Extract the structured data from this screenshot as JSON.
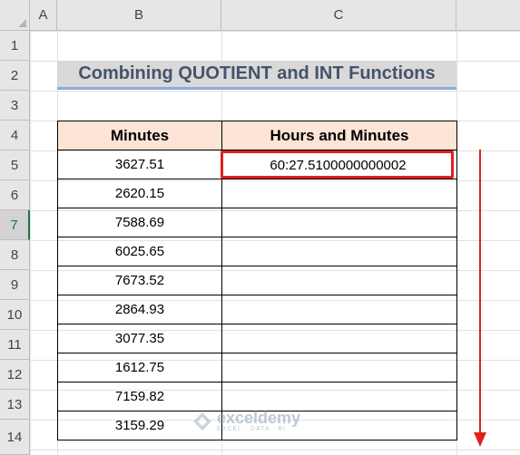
{
  "columns": [
    "A",
    "B",
    "C"
  ],
  "rows": [
    "1",
    "2",
    "3",
    "4",
    "5",
    "6",
    "7",
    "8",
    "9",
    "10",
    "11",
    "12",
    "13",
    "14"
  ],
  "title": "Combining QUOTIENT and INT Functions",
  "table": {
    "headers": [
      "Minutes",
      "Hours and Minutes"
    ],
    "minutes": [
      "3627.51",
      "2620.15",
      "7588.69",
      "6025.65",
      "7673.52",
      "2864.93",
      "3077.35",
      "1612.75",
      "7159.82",
      "3159.29"
    ],
    "result_c5": "60:27.5100000000002"
  },
  "watermark": {
    "name": "exceldemy",
    "tagline": "EXCEL · DATA · BI"
  },
  "colors": {
    "header_fill": "#fce4d6",
    "title_fill": "#d9d9d9",
    "highlight": "#e02020",
    "active_row": "#217346"
  }
}
